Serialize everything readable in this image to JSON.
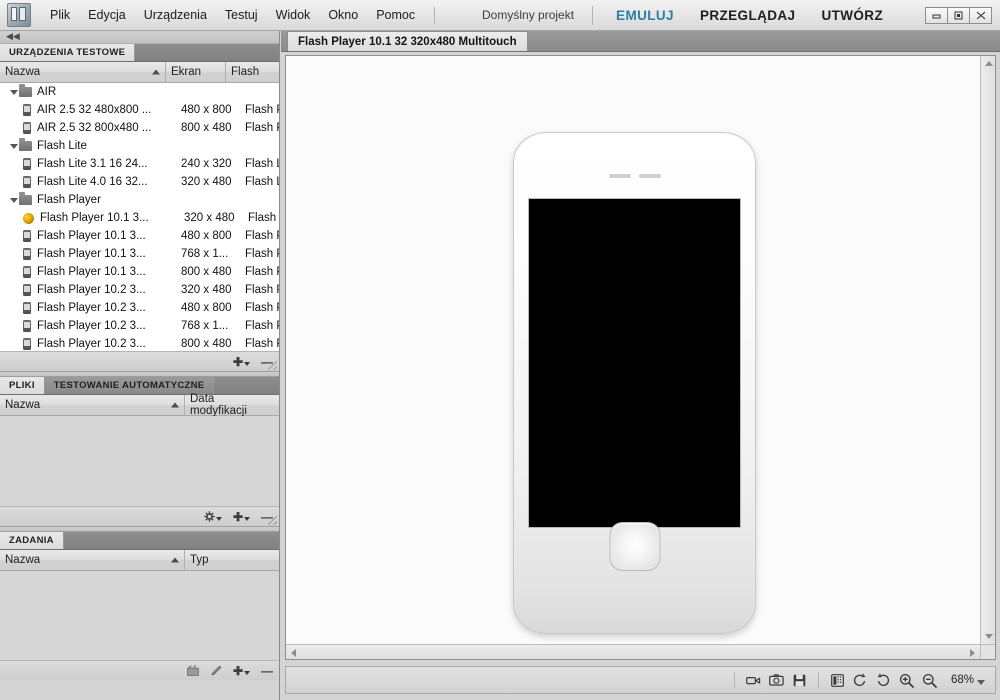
{
  "app": {
    "logo_icon": "device-central-logo-icon",
    "menus": [
      "Plik",
      "Edycja",
      "Urządzenia",
      "Testuj",
      "Widok",
      "Okno",
      "Pomoc"
    ],
    "project_name": "Domyślny projekt",
    "modes": [
      {
        "label": "EMULUJ",
        "active": true
      },
      {
        "label": "PRZEGLĄDAJ",
        "active": false
      },
      {
        "label": "UTWÓRZ",
        "active": false
      }
    ],
    "window_buttons": [
      {
        "name": "minimize-button",
        "glyph": "▭"
      },
      {
        "name": "maximize-button",
        "glyph": "▣"
      },
      {
        "name": "close-button",
        "glyph": "✕"
      }
    ]
  },
  "devices_panel": {
    "tab_label": "URZĄDZENIA TESTOWE",
    "columns": [
      "Nazwa",
      "Ekran",
      "Flash"
    ],
    "sort_column": "Nazwa",
    "groups": [
      {
        "name": "AIR",
        "expanded": true,
        "items": [
          {
            "name": "AIR 2.5 32 480x800 ...",
            "screen": "480 x 800",
            "flash": "Flash Play",
            "icon": "device-icon"
          },
          {
            "name": "AIR 2.5 32 800x480 ...",
            "screen": "800 x 480",
            "flash": "Flash Play",
            "icon": "device-icon"
          }
        ]
      },
      {
        "name": "Flash Lite",
        "expanded": true,
        "items": [
          {
            "name": "Flash Lite 3.1 16 24...",
            "screen": "240 x 320",
            "flash": "Flash Lite",
            "icon": "device-icon"
          },
          {
            "name": "Flash Lite 4.0 16 32...",
            "screen": "320 x 480",
            "flash": "Flash Lite",
            "icon": "device-icon"
          }
        ]
      },
      {
        "name": "Flash Player",
        "expanded": true,
        "items": [
          {
            "name": "Flash Player 10.1 3...",
            "screen": "320 x 480",
            "flash": "Flash Play",
            "icon": "globe-icon"
          },
          {
            "name": "Flash Player 10.1 3...",
            "screen": "480 x 800",
            "flash": "Flash Play",
            "icon": "device-icon"
          },
          {
            "name": "Flash Player 10.1 3...",
            "screen": "768 x 1...",
            "flash": "Flash Play",
            "icon": "device-icon"
          },
          {
            "name": "Flash Player 10.1 3...",
            "screen": "800 x 480",
            "flash": "Flash Play",
            "icon": "device-icon"
          },
          {
            "name": "Flash Player 10.2 3...",
            "screen": "320 x 480",
            "flash": "Flash Play",
            "icon": "device-icon"
          },
          {
            "name": "Flash Player 10.2 3...",
            "screen": "480 x 800",
            "flash": "Flash Play",
            "icon": "device-icon"
          },
          {
            "name": "Flash Player 10.2 3...",
            "screen": "768 x 1...",
            "flash": "Flash Play",
            "icon": "device-icon"
          },
          {
            "name": "Flash Player 10.2 3...",
            "screen": "800 x 480",
            "flash": "Flash Play",
            "icon": "device-icon"
          }
        ]
      }
    ],
    "toolbar": [
      {
        "name": "add-device-button",
        "glyph": "✚",
        "caret": true
      },
      {
        "name": "remove-device-button",
        "glyph": "—",
        "caret": false
      }
    ]
  },
  "files_panel": {
    "tabs": [
      {
        "label": "PLIKI",
        "active": true
      },
      {
        "label": "TESTOWANIE AUTOMATYCZNE",
        "active": false
      }
    ],
    "columns": [
      "Nazwa",
      "Data modyfikacji"
    ],
    "sort_column": "Nazwa",
    "rows": [],
    "toolbar": [
      {
        "name": "settings-button",
        "glyph": "✲",
        "caret": true
      },
      {
        "name": "add-file-button",
        "glyph": "✚",
        "caret": true
      },
      {
        "name": "remove-file-button",
        "glyph": "—",
        "caret": false
      }
    ]
  },
  "tasks_panel": {
    "tab_label": "ZADANIA",
    "columns": [
      "Nazwa",
      "Typ"
    ],
    "sort_column": "Nazwa",
    "rows": [],
    "toolbar": [
      {
        "name": "record-task-button",
        "glyph": "▦",
        "caret": false
      },
      {
        "name": "edit-task-button",
        "glyph": "✎",
        "caret": false
      },
      {
        "name": "add-task-button",
        "glyph": "✚",
        "caret": true
      },
      {
        "name": "remove-task-button",
        "glyph": "—",
        "caret": false
      }
    ]
  },
  "workspace": {
    "document_tab": "Flash Player 10.1 32 320x480 Multitouch",
    "device_preview": {
      "name": "phone-emulator",
      "screen_state": "blank-black",
      "home_button": "home-button"
    },
    "bottom_toolbar": {
      "buttons": [
        {
          "name": "record-video-button",
          "glyph": "▭"
        },
        {
          "name": "screenshot-button",
          "glyph": "◉"
        },
        {
          "name": "save-button",
          "glyph": "▤"
        },
        {
          "name": "device-info-button",
          "glyph": "▥"
        },
        {
          "name": "rotate-left-button",
          "glyph": "↺"
        },
        {
          "name": "rotate-right-button",
          "glyph": "↻"
        },
        {
          "name": "zoom-in-button",
          "glyph": "＋"
        },
        {
          "name": "zoom-out-button",
          "glyph": "－"
        }
      ],
      "zoom_value": "68%"
    }
  }
}
